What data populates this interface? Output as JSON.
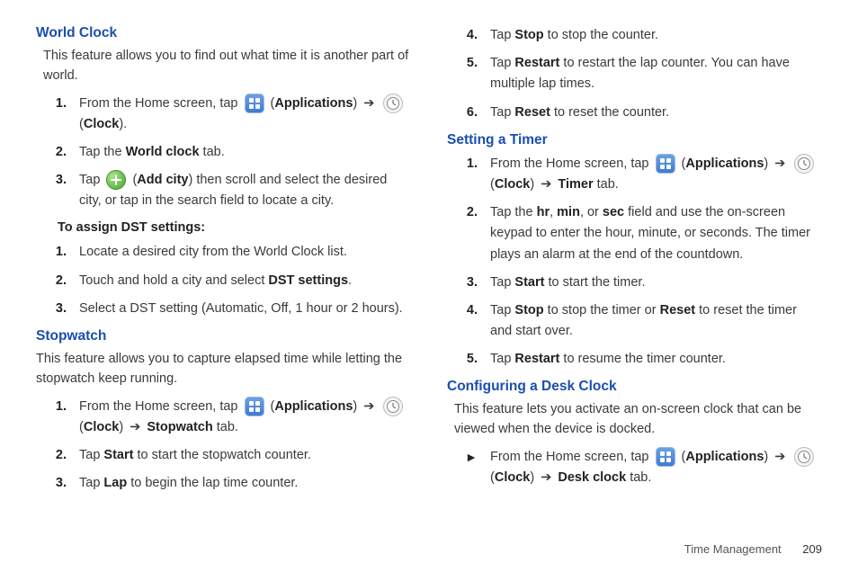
{
  "arrow": "➔",
  "footer": {
    "section": "Time Management",
    "page": "209"
  },
  "left": {
    "worldClock": {
      "title": "World Clock",
      "intro": "This feature allows you to find out what time it is another part of world.",
      "steps": [
        {
          "n": "1.",
          "pre": "From the Home screen, tap ",
          "apps": "Applications",
          "mid1": ") ",
          "clock": "Clock",
          "post": ")."
        },
        {
          "n": "2.",
          "pre": "Tap the ",
          "b1": "World clock",
          "post": " tab."
        },
        {
          "n": "3.",
          "pre": "Tap ",
          "b1": "Add city",
          "mid": ") then scroll and select the desired city, or tap in the search field to locate a city."
        }
      ],
      "dst": {
        "title": "To assign DST settings:",
        "steps": [
          {
            "n": "1.",
            "text": "Locate a desired city from the World Clock list."
          },
          {
            "n": "2.",
            "pre": "Touch and hold a city and select ",
            "b1": "DST settings",
            "post": "."
          },
          {
            "n": "3.",
            "text": "Select a DST setting (Automatic, Off, 1 hour or 2 hours)."
          }
        ]
      }
    },
    "stopwatch": {
      "title": "Stopwatch",
      "intro": "This feature allows you to capture elapsed time while letting the stopwatch keep running.",
      "steps": [
        {
          "n": "1.",
          "pre": "From the Home screen, tap ",
          "apps": "Applications",
          "mid1": ") ",
          "clock": "Clock",
          "mid2": ") ",
          "tab": "Stopwatch",
          "post": " tab."
        },
        {
          "n": "2.",
          "pre": "Tap ",
          "b1": "Start",
          "post": " to start the stopwatch counter."
        },
        {
          "n": "3.",
          "pre": "Tap ",
          "b1": "Lap",
          "post": " to begin the lap time counter."
        }
      ]
    }
  },
  "right": {
    "contSteps": [
      {
        "n": "4.",
        "pre": "Tap ",
        "b1": "Stop",
        "post": " to stop the counter."
      },
      {
        "n": "5.",
        "pre": "Tap ",
        "b1": "Restart",
        "post": " to restart the lap counter. You can have multiple lap times."
      },
      {
        "n": "6.",
        "pre": "Tap ",
        "b1": "Reset",
        "post": " to reset the counter."
      }
    ],
    "timer": {
      "title": "Setting a Timer",
      "steps": [
        {
          "n": "1.",
          "pre": "From the Home screen, tap ",
          "apps": "Applications",
          "mid1": ") ",
          "clock": "Clock",
          "mid2": ") ",
          "tab": "Timer",
          "post": " tab."
        },
        {
          "n": "2.",
          "pre": "Tap the ",
          "b1": "hr",
          "c1": ", ",
          "b2": "min",
          "c2": ", or ",
          "b3": "sec",
          "post": " field and use the on-screen keypad to enter the hour, minute, or seconds. The timer plays an alarm at the end of the countdown."
        },
        {
          "n": "3.",
          "pre": "Tap ",
          "b1": "Start",
          "post": " to start the timer."
        },
        {
          "n": "4.",
          "pre": "Tap ",
          "b1": "Stop",
          "mid": " to stop the timer or ",
          "b2": "Reset",
          "post": " to reset the timer and start over."
        },
        {
          "n": "5.",
          "pre": "Tap ",
          "b1": "Restart",
          "post": " to resume the timer counter."
        }
      ]
    },
    "desk": {
      "title": "Configuring a Desk Clock",
      "intro": "This feature lets you activate an on-screen clock that can be viewed when the device is docked.",
      "bullet": {
        "pre": "From the Home screen, tap ",
        "apps": "Applications",
        "mid1": ") ",
        "clock": "Clock",
        "mid2": ") ",
        "tab": "Desk clock",
        "post": " tab."
      }
    }
  }
}
